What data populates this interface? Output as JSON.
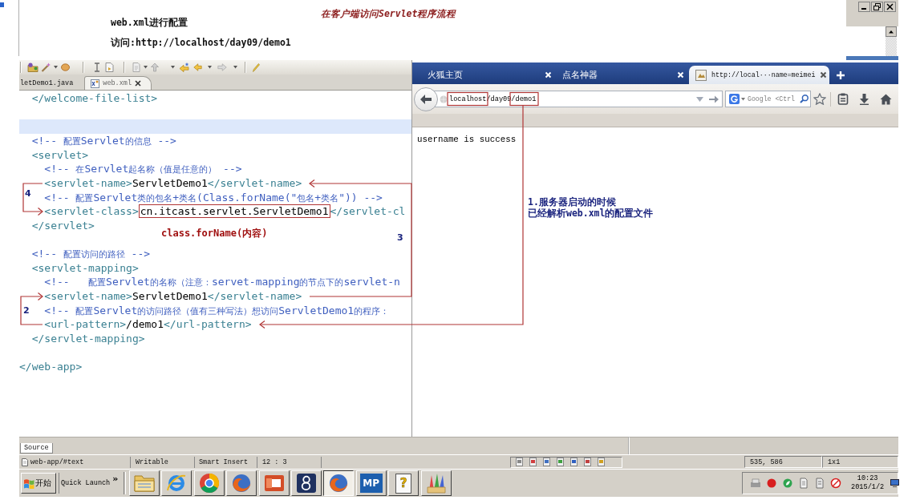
{
  "notes": {
    "title": "在客户端访问Servlet程序流程",
    "lines": [
      "web.xml进行配置",
      "访问:http://localhost/day09/demo1"
    ]
  },
  "editor": {
    "tabs": [
      {
        "label": "letDemo1.java",
        "selected": false
      },
      {
        "label": "web.xml",
        "selected": true
      }
    ],
    "lines": [
      {
        "tokens": [
          {
            "kind": "tag",
            "text": "  </welcome-file-list>",
            "framed": false
          }
        ],
        "highlighted": false
      },
      {
        "highlighted": false
      },
      {
        "highlighted": true
      },
      {
        "tokens": [
          {
            "kind": "comment",
            "text": "  <!-- 配置Servlet的信息 -->",
            "framed": false
          }
        ],
        "highlighted": false
      },
      {
        "tokens": [
          {
            "kind": "tag",
            "text": "  <servlet>",
            "framed": false
          }
        ],
        "highlighted": false
      },
      {
        "tokens": [
          {
            "kind": "comment",
            "text": "    <!-- 在Servlet起名称（值是任意的） -->",
            "framed": false
          }
        ],
        "highlighted": false
      },
      {
        "tokens": [
          {
            "kind": "tag",
            "text": "    <servlet-name>",
            "framed": false
          },
          {
            "kind": "text",
            "text": "ServletDemo1",
            "framed": false
          },
          {
            "kind": "tag",
            "text": "</servlet-name>",
            "framed": false
          }
        ],
        "highlighted": false
      },
      {
        "tokens": [
          {
            "kind": "comment",
            "text": "    <!-- 配置Servlet类的包名+类名(Class.forName(\"包名+类名\")) -->",
            "framed": false
          }
        ],
        "highlighted": false
      },
      {
        "tokens": [
          {
            "kind": "tag",
            "text": "    <servlet-class>",
            "framed": false
          },
          {
            "kind": "text",
            "text": "cn.itcast.servlet.ServletDemo1",
            "framed": true
          },
          {
            "kind": "tag",
            "text": "</servlet-cl",
            "framed": false
          }
        ],
        "highlighted": false
      },
      {
        "tokens": [
          {
            "kind": "tag",
            "text": "  </servlet>",
            "framed": false
          }
        ],
        "highlighted": false
      },
      {
        "highlighted": false
      },
      {
        "tokens": [
          {
            "kind": "comment",
            "text": "  <!-- 配置访问的路径 -->",
            "framed": false
          }
        ],
        "highlighted": false
      },
      {
        "tokens": [
          {
            "kind": "tag",
            "text": "  <servlet-mapping>",
            "framed": false
          }
        ],
        "highlighted": false
      },
      {
        "tokens": [
          {
            "kind": "comment",
            "text": "    <!--   配置Servlet的名称（注意：servet-mapping的节点下的servlet-n",
            "framed": false
          }
        ],
        "highlighted": false
      },
      {
        "tokens": [
          {
            "kind": "tag",
            "text": "    <servlet-name>",
            "framed": false
          },
          {
            "kind": "text",
            "text": "ServletDemo1",
            "framed": false
          },
          {
            "kind": "tag",
            "text": "</servlet-name>",
            "framed": false
          }
        ],
        "highlighted": false
      },
      {
        "tokens": [
          {
            "kind": "comment",
            "text": "    <!-- 配置Servlet的访问路径（值有三种写法）想访问ServletDemo1的程序：",
            "framed": false
          }
        ],
        "highlighted": false
      },
      {
        "tokens": [
          {
            "kind": "tag",
            "text": "    <url-pattern>",
            "framed": false
          },
          {
            "kind": "text",
            "text": "/demo1",
            "framed": false
          },
          {
            "kind": "tag",
            "text": "</url-pattern>",
            "framed": false
          }
        ],
        "highlighted": false
      },
      {
        "tokens": [
          {
            "kind": "tag",
            "text": "  </servlet-mapping>",
            "framed": false
          }
        ],
        "highlighted": false
      },
      {
        "highlighted": false
      },
      {
        "tokens": [
          {
            "kind": "tag",
            "text": "</web-app>",
            "framed": false
          }
        ],
        "highlighted": false
      }
    ],
    "view_tabs": [
      {
        "label": "Source",
        "selected": true
      }
    ]
  },
  "browser": {
    "tabs": [
      {
        "label": "火狐主页",
        "selected": false,
        "favicon": false
      },
      {
        "label": "点名神器",
        "selected": false,
        "favicon": false
      },
      {
        "label": "http://local···name=meimei",
        "selected": true,
        "favicon": true
      }
    ],
    "address": "localhost/day09/demo1",
    "search": {
      "placeholder": "Google <Ctrl"
    },
    "content": "username is success"
  },
  "annotations": {
    "callout": "class.forName(内容)",
    "steps": [
      {
        "label": "4"
      },
      {
        "label": "3"
      },
      {
        "label": "2"
      }
    ],
    "server_note": [
      "1.服务器启动的时候",
      "已经解析web.xml的配置文件"
    ]
  },
  "status_bar": {
    "fields": [
      "web-app/#text",
      "Writable",
      "Smart Insert",
      "12 : 3"
    ],
    "coordinates": "535, 586",
    "size": "1x1"
  },
  "taskbar": {
    "start": "开始",
    "quick_launch": "Quick Launch",
    "more": "»",
    "apps": [
      {
        "kind": "folder",
        "selected": false
      },
      {
        "kind": "e-globe",
        "selected": false
      },
      {
        "kind": "wheel",
        "selected": false
      },
      {
        "kind": "fox",
        "selected": false
      },
      {
        "kind": "slides",
        "selected": false
      },
      {
        "kind": "eight",
        "selected": false
      },
      {
        "kind": "fox",
        "selected": true
      },
      {
        "kind": "badge",
        "label": "MP",
        "selected": false
      },
      {
        "kind": "help",
        "label": "?",
        "selected": false
      },
      {
        "kind": "pencils",
        "selected": false
      }
    ],
    "time": "10:23",
    "date": "2015/1/2"
  }
}
